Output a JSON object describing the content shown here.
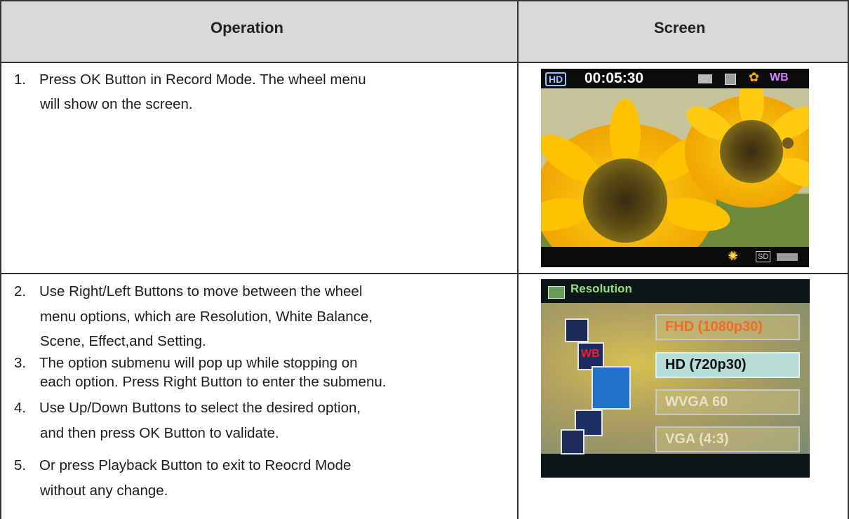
{
  "table": {
    "header_operation": "Operation",
    "header_screen": "Screen"
  },
  "steps": {
    "s1_num": "1.",
    "s1_line1": "Press OK Button in Record Mode. The wheel menu",
    "s1_line2": "will show on the screen.",
    "s2_num": "2.",
    "s2_line1": "Use Right/Left Buttons to move between the wheel",
    "s2_line2": "menu options, which are Resolution, White Balance,",
    "s2_line3": "Scene, Effect,and Setting.",
    "s3_num": "3.",
    "s3_line1": "The option submenu will pop up while stopping on",
    "s3_line2": "each option. Press Right Button to enter the submenu.",
    "s4_num": "4.",
    "s4_line1": "Use Up/Down Buttons to select the desired option,",
    "s4_line2": "and then press OK Button to validate.",
    "s5_num": "5.",
    "s5_line1": "Or press Playback Button to exit to Reocrd Mode",
    "s5_line2": "without any change."
  },
  "screen1": {
    "hd_badge": "HD",
    "timer": "00:05:30",
    "wb_label": "WB",
    "sd_label": "SD"
  },
  "screen2": {
    "title": "Resolution",
    "options": [
      "FHD (1080p30)",
      "HD (720p30)",
      "WVGA 60",
      "VGA (4:3)"
    ]
  },
  "colors": {
    "header_bg": "#d9d9d9",
    "resolution_title": "#8fe07a",
    "highlight_option": "#f16b24",
    "selected_option_bg": "#b6ddd6"
  }
}
